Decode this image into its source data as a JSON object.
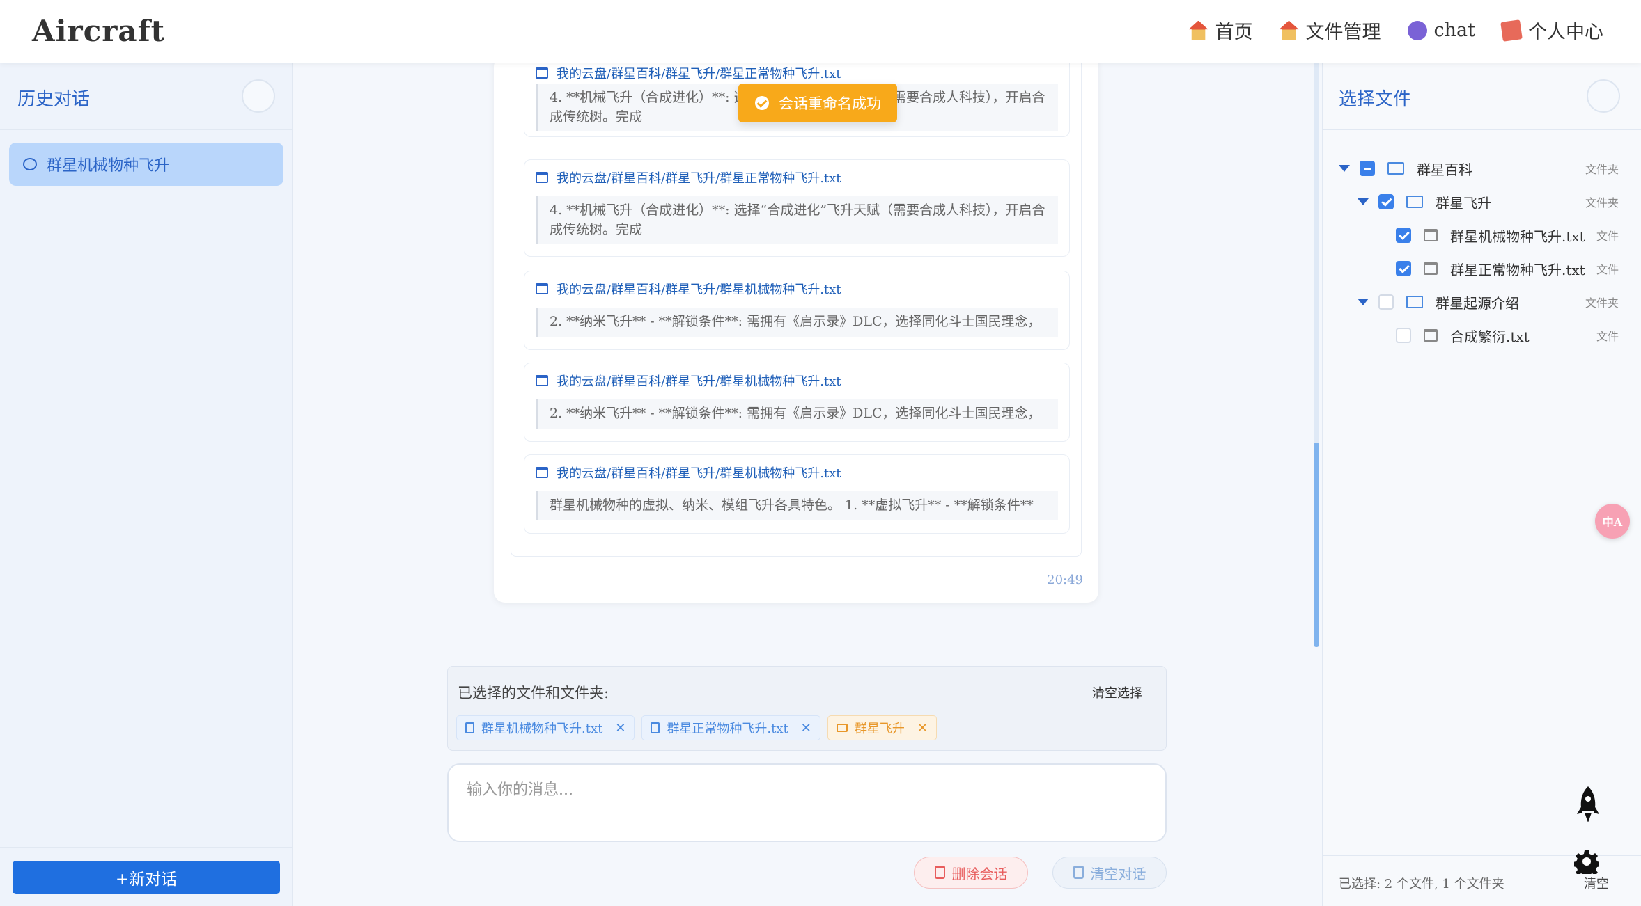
{
  "app": {
    "logo": "Aircraft"
  },
  "nav": [
    {
      "label": "首页",
      "icon": "home-icon"
    },
    {
      "label": "文件管理",
      "icon": "home-icon"
    },
    {
      "label": "chat",
      "icon": "robot-icon"
    },
    {
      "label": "个人中心",
      "icon": "user-doc-icon"
    }
  ],
  "sidebar": {
    "title": "历史对话",
    "conversations": [
      {
        "label": "群星机械物种飞升"
      }
    ],
    "new_button": "+新对话"
  },
  "toast": {
    "text": "会话重命名成功"
  },
  "message": {
    "references": [
      {
        "path": "我的云盘/群星百科/群星飞升/群星正常物种飞升.txt",
        "text": "4. **机械飞升（合成进化）**: 选择“合成进化”飞升天赋（需要合成人科技），开启合成传统树。完成"
      },
      {
        "path": "我的云盘/群星百科/群星飞升/群星正常物种飞升.txt",
        "text": "4. **机械飞升（合成进化）**: 选择“合成进化”飞升天赋（需要合成人科技），开启合成传统树。完成"
      },
      {
        "path": "我的云盘/群星百科/群星飞升/群星机械物种飞升.txt",
        "text": "2. **纳米飞升** - **解锁条件**: 需拥有《启示录》DLC，选择同化斗士国民理念，"
      },
      {
        "path": "我的云盘/群星百科/群星飞升/群星机械物种飞升.txt",
        "text": "2. **纳米飞升** - **解锁条件**: 需拥有《启示录》DLC，选择同化斗士国民理念，"
      },
      {
        "path": "我的云盘/群星百科/群星飞升/群星机械物种飞升.txt",
        "text": "群星机械物种的虚拟、纳米、模组飞升各具特色。 1. **虚拟飞升** - **解锁条件**"
      }
    ],
    "time": "20:49"
  },
  "selection": {
    "title": "已选择的文件和文件夹:",
    "clear_label": "清空选择",
    "tags": [
      {
        "label": "群星机械物种飞升.txt",
        "kind": "file"
      },
      {
        "label": "群星正常物种飞升.txt",
        "kind": "file"
      },
      {
        "label": "群星飞升",
        "kind": "folder"
      }
    ]
  },
  "input": {
    "placeholder": "输入你的消息..."
  },
  "actions": {
    "delete_label": "删除会话",
    "clear_label": "清空对话"
  },
  "file_panel": {
    "title": "选择文件",
    "tree": [
      {
        "label": "群星百科",
        "type": "文件夹",
        "state": "partial",
        "kind": "folder",
        "expanded": true
      },
      {
        "label": "群星飞升",
        "type": "文件夹",
        "state": "checked",
        "kind": "folder",
        "expanded": true
      },
      {
        "label": "群星机械物种飞升.txt",
        "type": "文件",
        "state": "checked",
        "kind": "file"
      },
      {
        "label": "群星正常物种飞升.txt",
        "type": "文件",
        "state": "checked",
        "kind": "file"
      },
      {
        "label": "群星起源介绍",
        "type": "文件夹",
        "state": "unchecked",
        "kind": "folder",
        "expanded": true
      },
      {
        "label": "合成繁衍.txt",
        "type": "文件",
        "state": "unchecked",
        "kind": "file"
      }
    ],
    "footer_text": "已选择: 2 个文件, 1 个文件夹",
    "footer_clear": "清空"
  },
  "floating": {
    "translate_label": "中A"
  },
  "colors": {
    "accent": "#2b64c7",
    "primary_button": "#1f6fe0",
    "toast": "#f8a91a",
    "danger": "#e85d5d"
  }
}
